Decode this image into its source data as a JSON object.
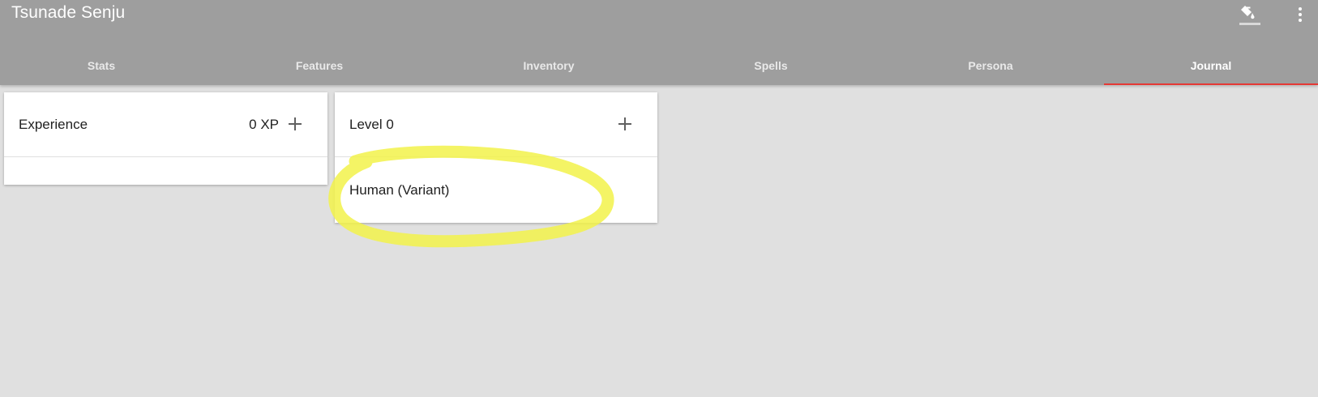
{
  "app": {
    "title": "Tsunade Senju"
  },
  "toolbar": {
    "paint_icon": "format-paint-icon",
    "more_icon": "more-vert-icon"
  },
  "tabs": [
    {
      "label": "Stats"
    },
    {
      "label": "Features"
    },
    {
      "label": "Inventory"
    },
    {
      "label": "Spells"
    },
    {
      "label": "Persona"
    },
    {
      "label": "Journal"
    }
  ],
  "active_tab": "Journal",
  "colors": {
    "header": "#9e9e9e",
    "background": "#e0e0e0",
    "active_indicator": "#e53935",
    "highlight": "#f2f24a"
  },
  "experience_card": {
    "label": "Experience",
    "value": "0 XP",
    "add_icon": "plus-icon"
  },
  "level_card": {
    "label": "Level 0",
    "add_icon": "plus-icon",
    "items": [
      {
        "label": "Human (Variant)"
      }
    ]
  }
}
